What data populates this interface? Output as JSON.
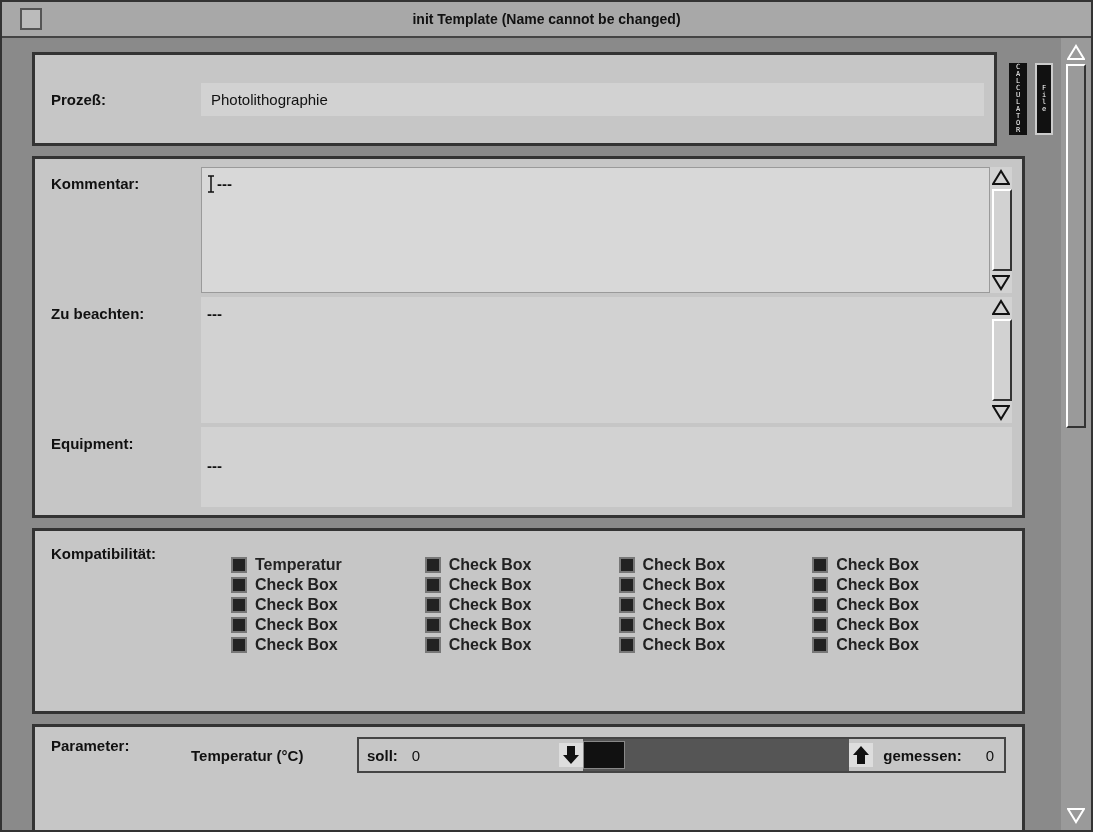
{
  "window": {
    "title": "init Template (Name cannot be changed)"
  },
  "side_buttons": [
    {
      "label": "CALCULATOR",
      "kind": "dark"
    },
    {
      "label": "File",
      "kind": "outlined"
    }
  ],
  "process": {
    "label": "Prozeß:",
    "value": "Photolithographie"
  },
  "text_fields": [
    {
      "label": "Kommentar:",
      "value": "---",
      "scrollbar": true,
      "focused": true
    },
    {
      "label": "Zu beachten:",
      "value": "---",
      "scrollbar": true,
      "focused": false
    },
    {
      "label": "Equipment:",
      "value": "---",
      "scrollbar": false,
      "focused": false
    }
  ],
  "compatibility": {
    "label": "Kompatibilität:",
    "columns": [
      [
        {
          "label": "Temperatur",
          "checked": true
        },
        {
          "label": "Check Box",
          "checked": true
        },
        {
          "label": "Check Box",
          "checked": true
        },
        {
          "label": "Check Box",
          "checked": true
        },
        {
          "label": "Check Box",
          "checked": true
        }
      ],
      [
        {
          "label": "Check Box",
          "checked": true
        },
        {
          "label": "Check Box",
          "checked": true
        },
        {
          "label": "Check Box",
          "checked": true
        },
        {
          "label": "Check Box",
          "checked": true
        },
        {
          "label": "Check Box",
          "checked": true
        }
      ],
      [
        {
          "label": "Check Box",
          "checked": true
        },
        {
          "label": "Check Box",
          "checked": true
        },
        {
          "label": "Check Box",
          "checked": true
        },
        {
          "label": "Check Box",
          "checked": true
        },
        {
          "label": "Check Box",
          "checked": true
        }
      ],
      [
        {
          "label": "Check Box",
          "checked": true
        },
        {
          "label": "Check Box",
          "checked": true
        },
        {
          "label": "Check Box",
          "checked": true
        },
        {
          "label": "Check Box",
          "checked": true
        },
        {
          "label": "Check Box",
          "checked": true
        }
      ]
    ]
  },
  "parameter": {
    "label": "Parameter:",
    "name": "Temperatur (°C)",
    "target_label": "soll:",
    "target_value": "0",
    "level": 0,
    "measured_label": "gemessen:",
    "measured_value": "0"
  }
}
